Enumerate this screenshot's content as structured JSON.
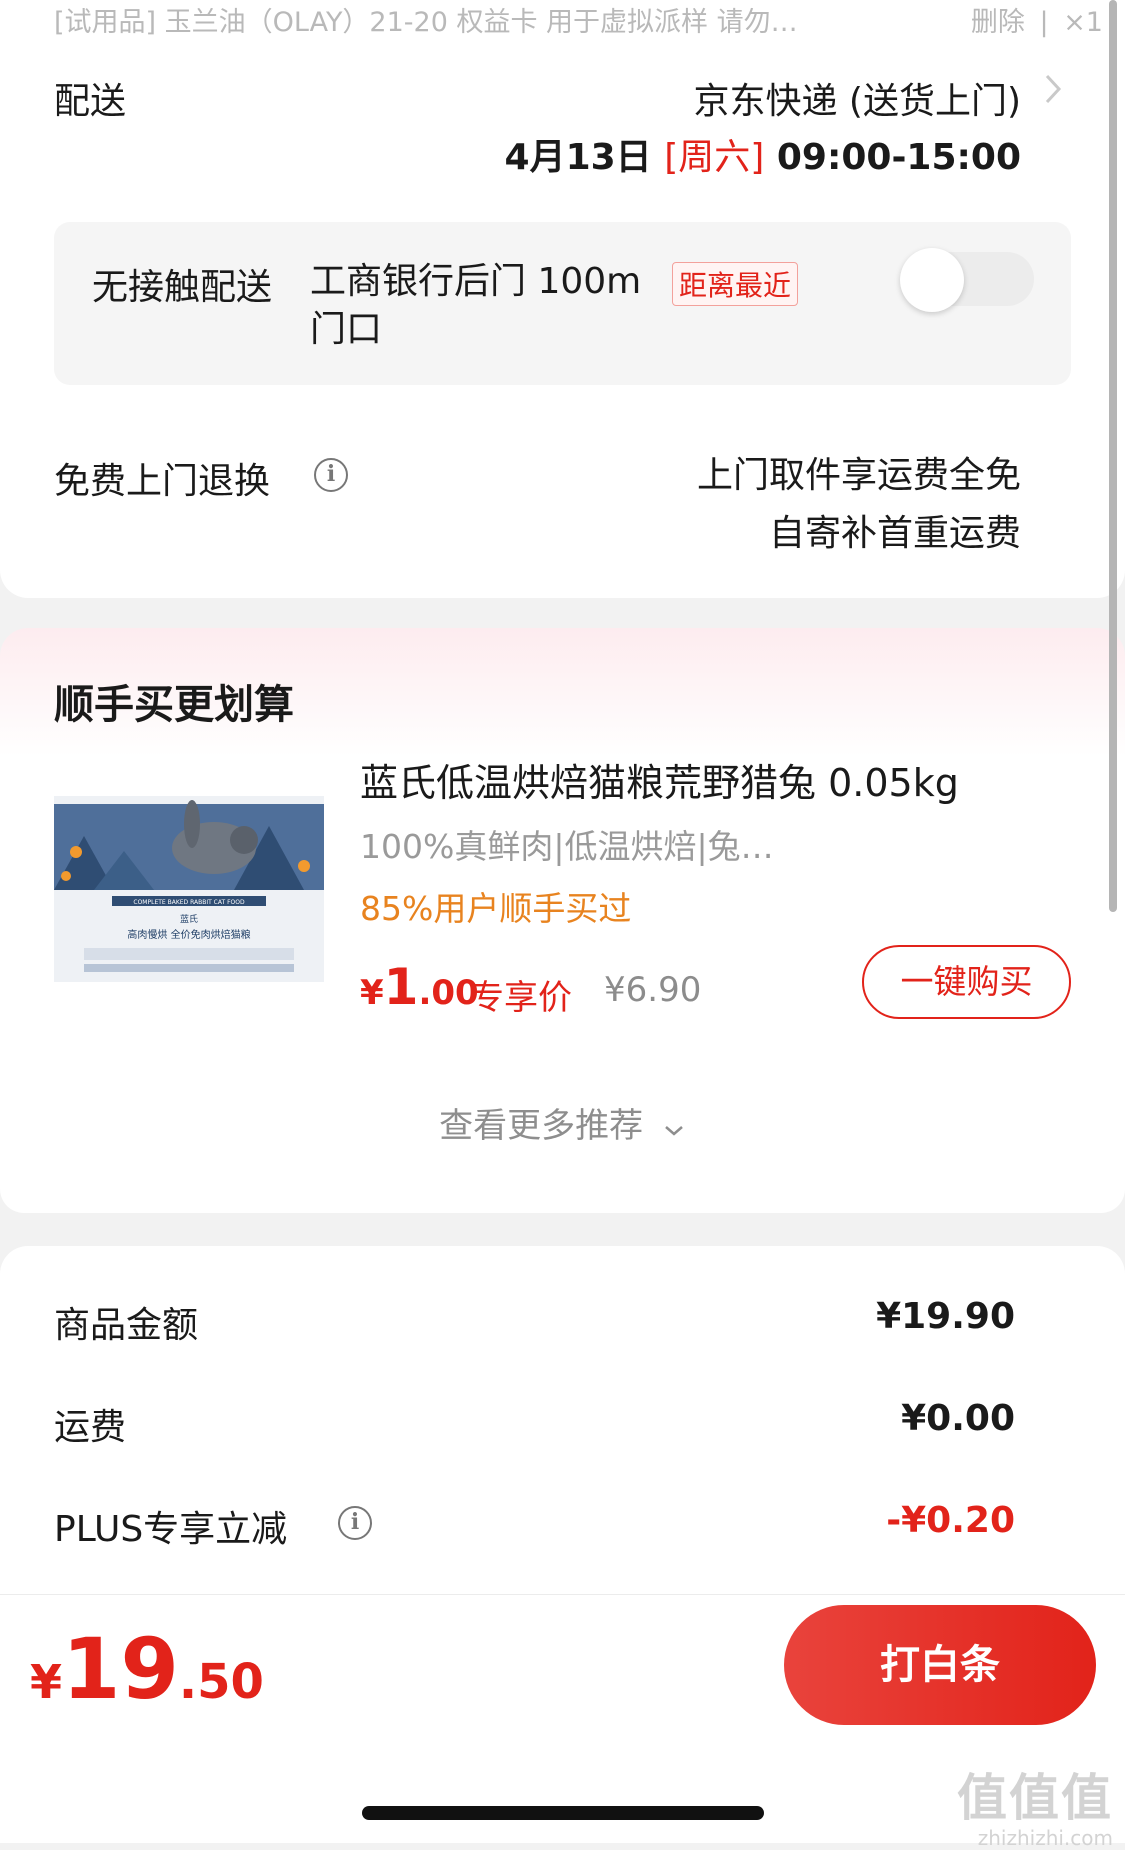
{
  "top_item": {
    "text": "[试用品] 玉兰油（OLAY）21-20 权益卡 用于虚拟派样 请勿…",
    "delete_label": "删除",
    "separator": "|",
    "quantity": "×1"
  },
  "delivery": {
    "label": "配送",
    "method": "京东快递 (送货上门)",
    "date": "4月13日",
    "weekday": "[周六]",
    "time": "09:00-15:00"
  },
  "contactless": {
    "title": "无接触配送",
    "place": "工商银行后门 100m 门口",
    "tag": "距离最近",
    "enabled": false
  },
  "returns": {
    "label": "免费上门退换",
    "line1": "上门取件享运费全免",
    "line2": "自寄补首重运费"
  },
  "recommend": {
    "title": "顺手买更划算",
    "product": {
      "name": "蓝氏低温烘焙猫粮荒野猎兔 0.05kg",
      "desc": "100%真鲜肉|低温烘焙|兔…",
      "stat": "85%用户顺手买过",
      "price_yen": "¥",
      "price_int": "1",
      "price_dec": ".00",
      "price_tag": "专享价",
      "orig_price": "¥6.90",
      "buy_label": "一键购买",
      "package_brand": "蓝氏",
      "package_en": "COMPLETE BAKED RABBIT CAT FOOD",
      "package_cn": "高肉慢烘 全价免肉烘焙猫粮"
    },
    "more_label": "查看更多推荐"
  },
  "summary": {
    "goods_label": "商品金额",
    "goods_value": "¥19.90",
    "shipping_label": "运费",
    "shipping_value": "¥0.00",
    "plus_label": "PLUS专享立减",
    "plus_value": "-¥0.20"
  },
  "checkout": {
    "total_yen": "¥",
    "total_int": "19",
    "total_dec": ".50",
    "pay_label": "打白条"
  },
  "watermark": {
    "big": "值值值",
    "small": "zhizhizhi.com"
  },
  "colors": {
    "accent_red": "#e2231a",
    "orange": "#e8831f",
    "gray_text": "#9a9a9a"
  }
}
